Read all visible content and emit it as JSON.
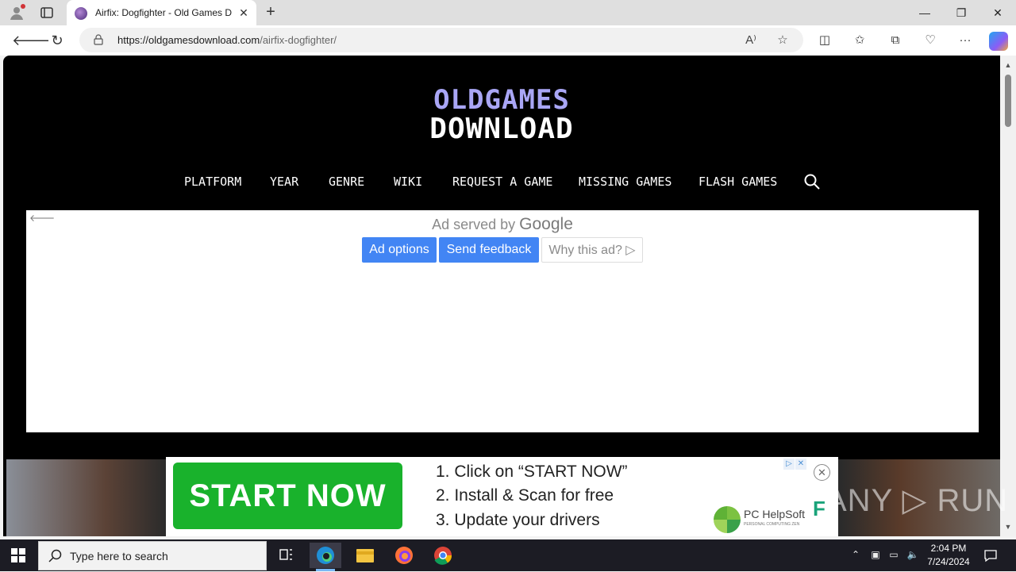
{
  "browser": {
    "tab_title": "Airfix: Dogfighter - Old Games D",
    "url_domain": "https://oldgamesdownload.com",
    "url_path": "/airfix-dogfighter/",
    "window_controls": {
      "minimize": "—",
      "restore": "❐",
      "close": "✕"
    }
  },
  "site": {
    "logo_line1": "OLDGAMES",
    "logo_line2": "DOWNLOAD",
    "menu": [
      "PLATFORM",
      "YEAR",
      "GENRE",
      "WIKI",
      "REQUEST A GAME",
      "MISSING GAMES",
      "FLASH GAMES"
    ]
  },
  "ad": {
    "served_by": "Ad served by",
    "google": "Google",
    "ad_options": "Ad options",
    "send_feedback": "Send feedback",
    "why_this_ad": "Why this ad? ▷",
    "back_arrow": "🡐"
  },
  "banner": {
    "start_now": "START NOW",
    "steps": [
      "1. Click on “START NOW”",
      "2. Install & Scan for free",
      "3. Update your drivers"
    ],
    "brand": "PC HelpSoft",
    "brand_sub": "PERSONAL COMPUTING ZEN"
  },
  "watermark": "ANY ▷ RUN",
  "taskbar": {
    "search_placeholder": "Type here to search",
    "time": "2:04 PM",
    "date": "7/24/2024"
  }
}
